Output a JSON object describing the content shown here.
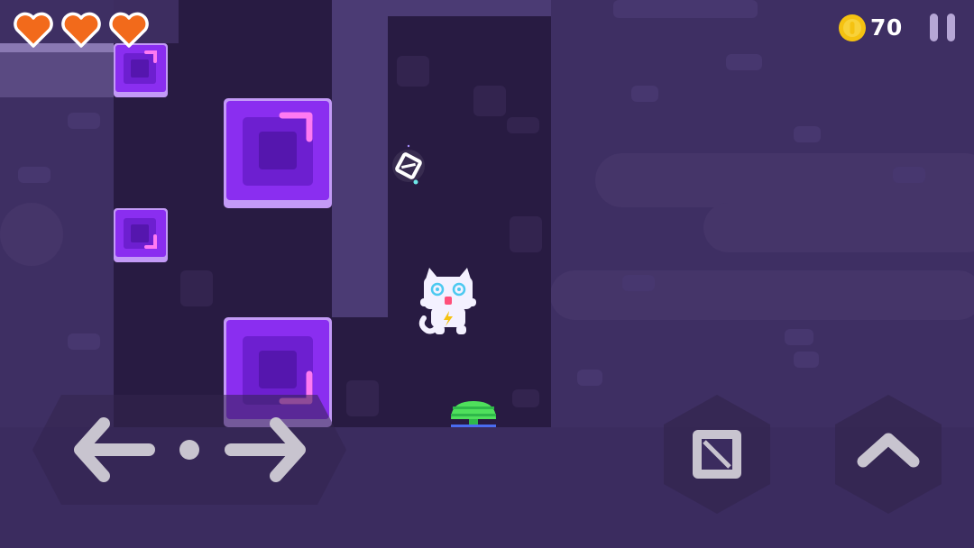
{
  "hud": {
    "lives": {
      "current": 3,
      "max": 3,
      "heart_color": "#f26a1b",
      "heart_icon": "heart-icon"
    },
    "coins": {
      "count": "70",
      "icon": "gold-coin-icon",
      "color": "#f5c211"
    },
    "pause": {
      "icon": "pause-icon"
    }
  },
  "controls": {
    "move_left": {
      "icon": "arrow-left-icon"
    },
    "move_right": {
      "icon": "arrow-right-icon"
    },
    "action": {
      "icon": "box-action-icon"
    },
    "jump": {
      "icon": "arrow-up-icon"
    }
  },
  "level": {
    "player": {
      "name": "white-cat",
      "icon": "cat-icon"
    },
    "pickup": {
      "icon": "crystal-cube-icon"
    },
    "bounce_pad": {
      "icon": "spring-pad-icon",
      "color": "#4fe05c"
    },
    "blocks": [
      "purple-block",
      "purple-block",
      "purple-block",
      "purple-block"
    ],
    "colors": {
      "background": "#3e2f63",
      "shaft": "#281b42",
      "block": "#8a2ef0",
      "block_highlight": "#ff7af2"
    }
  }
}
